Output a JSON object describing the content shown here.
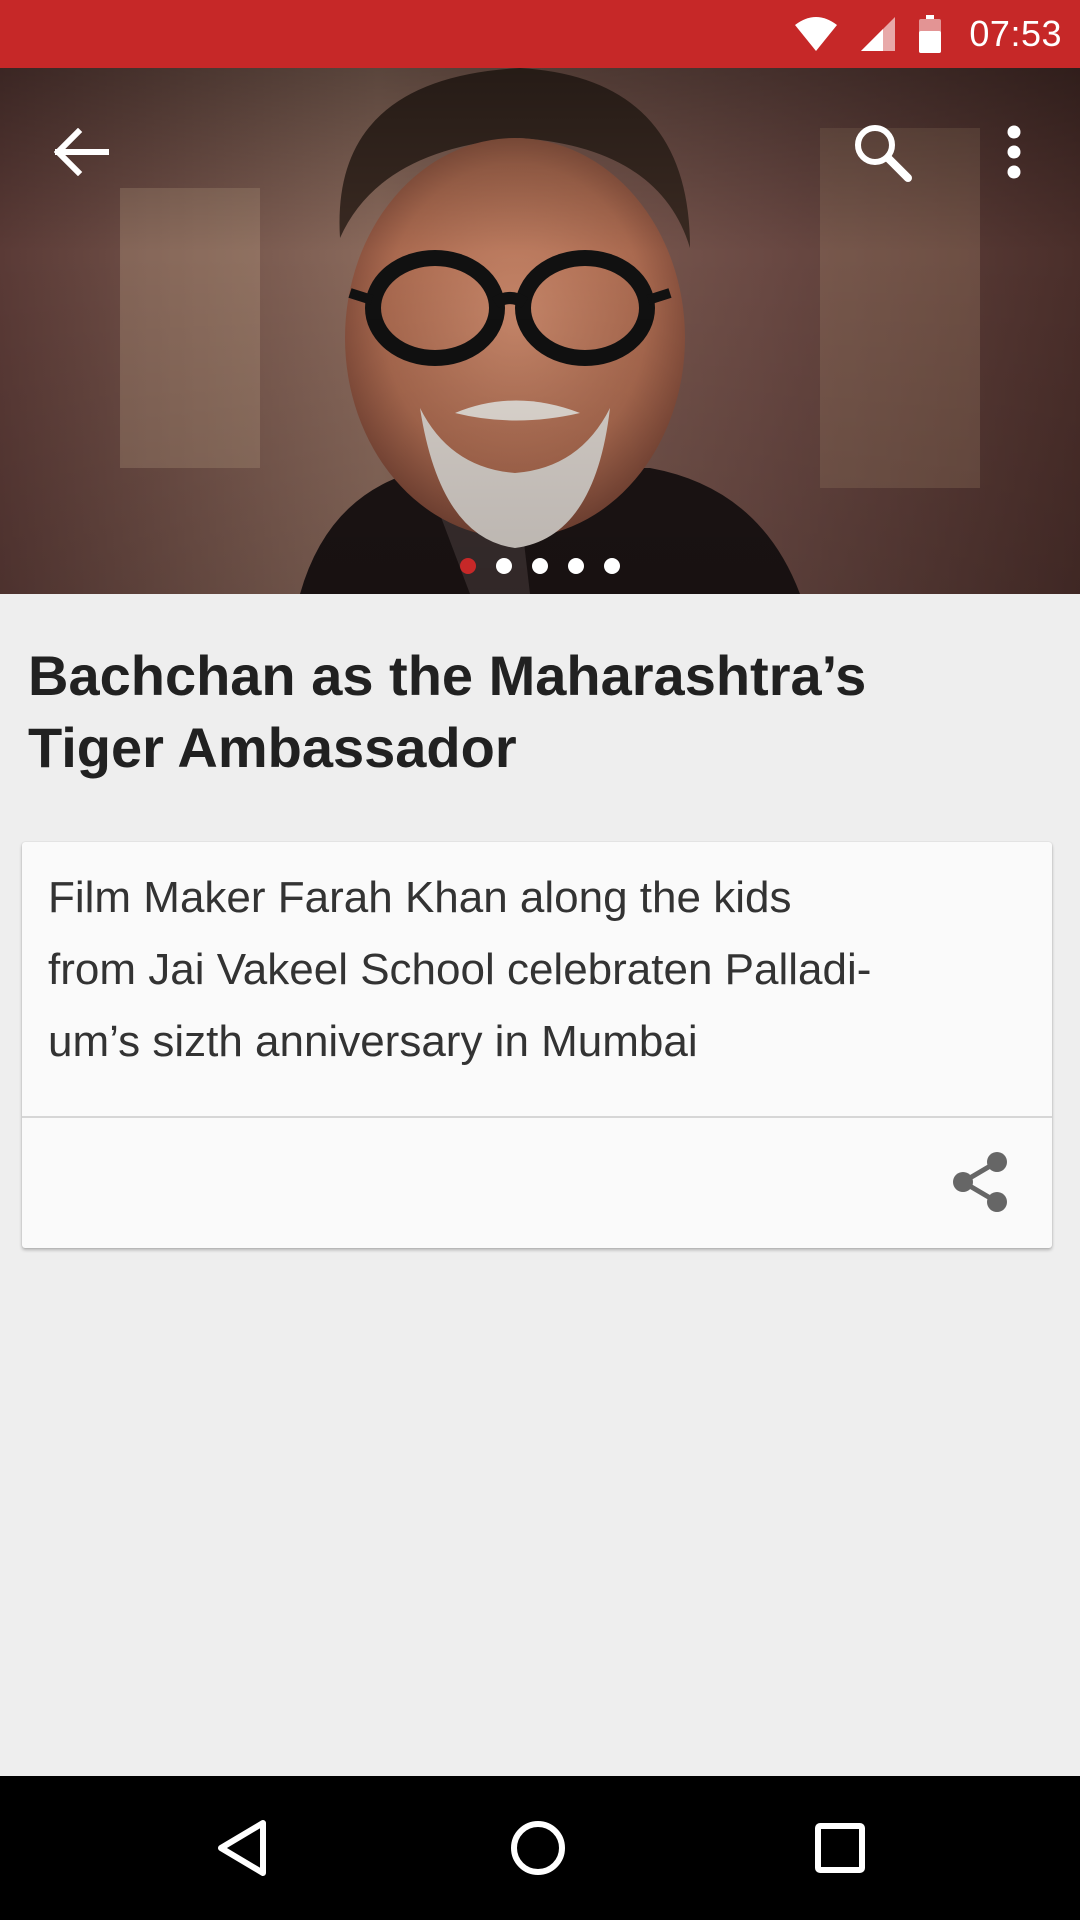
{
  "status_bar": {
    "time": "07:53",
    "icons": [
      "wifi-icon",
      "cell-signal-icon",
      "battery-icon"
    ]
  },
  "toolbar": {
    "icons": [
      "back-arrow-icon",
      "search-icon",
      "more-vertical-icon"
    ]
  },
  "carousel": {
    "total_slides": 5,
    "active_index": 0
  },
  "article": {
    "headline_line1": "Bachchan as the Maharashtra’s",
    "headline_line2": "Tiger Ambassador",
    "caption_line1": "Film Maker Farah Khan along the kids",
    "caption_line2": "from Jai Vakeel School celebraten Palladi-",
    "caption_line3": "um’s sizth anniversary in Mumbai",
    "share_icon": "share-icon"
  },
  "nav_bar": {
    "icons": [
      "nav-back-icon",
      "nav-home-icon",
      "nav-recents-icon"
    ]
  },
  "colors": {
    "accent": "#c62828",
    "background": "#eeeeee",
    "card": "#fafafa",
    "text": "#212121"
  }
}
